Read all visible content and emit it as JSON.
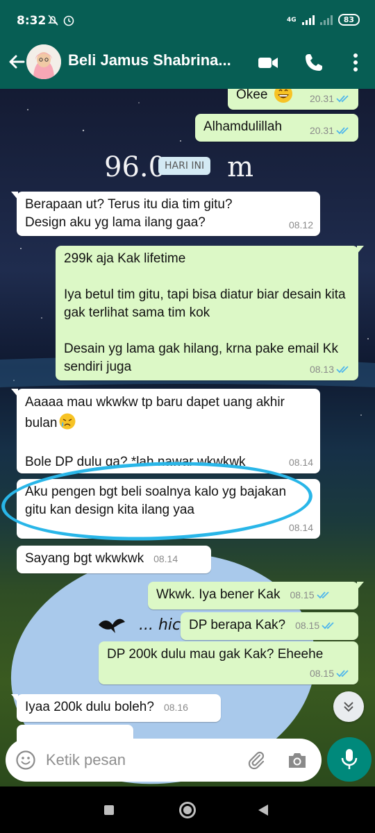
{
  "status": {
    "time": "8:32",
    "network": "4G",
    "battery": "83"
  },
  "header": {
    "title": "Beli Jamus Shabrina...",
    "colors": {
      "bar": "#075e54"
    }
  },
  "wallpaper": {
    "hand_text": "96.0",
    "hand_text_suffix": "m"
  },
  "chat": {
    "date_divider": "HARI INI",
    "messages": [
      {
        "dir": "out",
        "text": "Okee",
        "emoji": "grin",
        "time": "20.31",
        "status": "read"
      },
      {
        "dir": "out",
        "text": "Alhamdulillah",
        "time": "20.31",
        "status": "read"
      },
      {
        "dir": "in",
        "text": "Berapaan ut? Terus itu dia tim gitu?\nDesign aku yg lama ilang gaa?",
        "time": "08.12"
      },
      {
        "dir": "out",
        "text": "299k aja Kak lifetime\n\nIya betul tim gitu, tapi bisa diatur biar desain kita gak terlihat sama tim kok\n\nDesain yg lama gak hilang, krna pake email Kk sendiri juga",
        "time": "08.13",
        "status": "read"
      },
      {
        "dir": "in",
        "text": "Aaaaa mau wkwkw tp baru dapet uang akhir bulan",
        "text2": "Bole DP dulu ga? *lah nawar wkwkwk",
        "emoji": "cry",
        "time": "08.14"
      },
      {
        "dir": "in",
        "text": "Aku pengen bgt beli soalnya kalo yg bajakan gitu kan design kita ilang yaa",
        "time": "08.14"
      },
      {
        "dir": "in",
        "text": "Sayang bgt wkwkwk",
        "time": "08.14"
      },
      {
        "dir": "out",
        "text": "Wkwk. Iya bener Kak",
        "time": "08.15",
        "status": "read"
      },
      {
        "dir": "out",
        "text": "DP berapa Kak?",
        "time": "08.15",
        "status": "read"
      },
      {
        "dir": "out",
        "text": "DP 200k dulu mau gak Kak? Eheehe",
        "time": "08.15",
        "status": "read"
      },
      {
        "dir": "in",
        "text": "Iyaa 200k dulu boleh?",
        "time": "08.16"
      }
    ]
  },
  "composer": {
    "placeholder": "Ketik pesan"
  },
  "icons": [
    "back-arrow-icon",
    "video-call-icon",
    "phone-icon",
    "more-vert-icon",
    "emoji-icon",
    "attach-icon",
    "camera-icon",
    "mic-icon",
    "scroll-down-icon"
  ]
}
